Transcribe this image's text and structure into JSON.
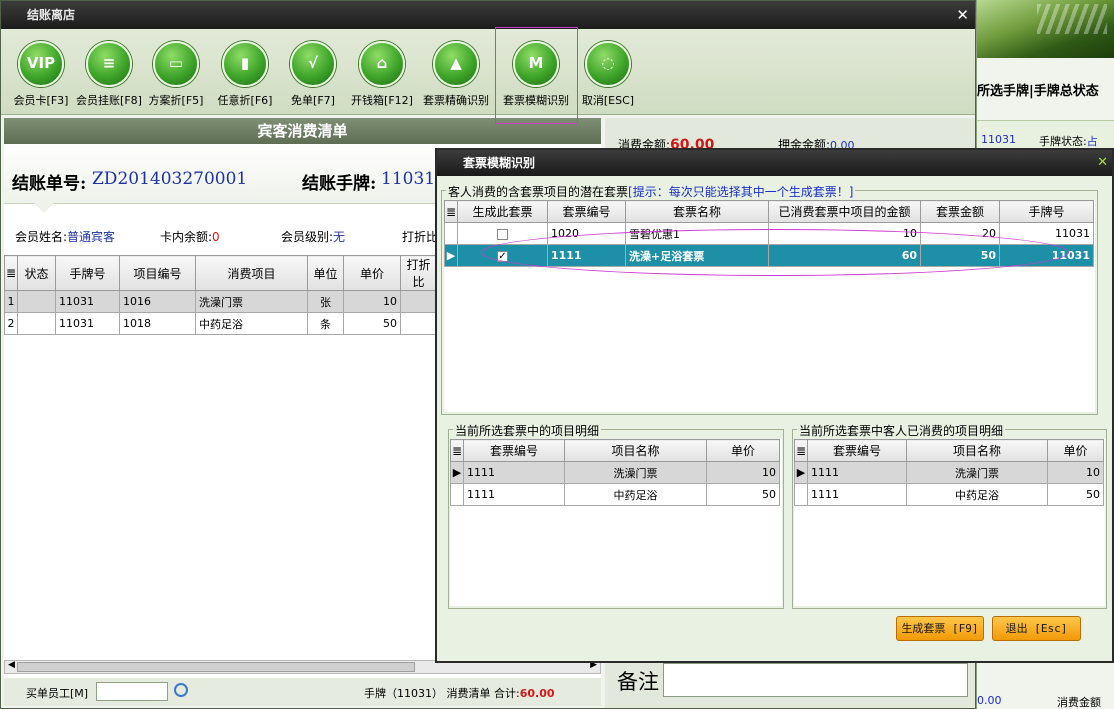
{
  "main_window": {
    "title": "结账离店",
    "toolbar": [
      {
        "icon": "vip-icon",
        "glyph": "VIP",
        "label": "会员卡[F3]"
      },
      {
        "icon": "member-account-icon",
        "glyph": "≡",
        "label": "会员挂账[F8]"
      },
      {
        "icon": "plan-discount-icon",
        "glyph": "▭",
        "label": "方案折[F5]"
      },
      {
        "icon": "any-discount-icon",
        "glyph": "▮",
        "label": "任意折[F6]"
      },
      {
        "icon": "free-order-icon",
        "glyph": "√",
        "label": "免单[F7]"
      },
      {
        "icon": "cash-box-icon",
        "glyph": "⌂",
        "label": "开钱箱[F12]"
      },
      {
        "icon": "exact-ticket-icon",
        "glyph": "▲",
        "label": "套票精确识别"
      },
      {
        "icon": "fuzzy-ticket-icon",
        "glyph": "M",
        "label": "套票模糊识别"
      },
      {
        "icon": "cancel-icon",
        "glyph": "◌",
        "label": "取消[ESC]"
      }
    ],
    "panel_title": "宾客消费清单",
    "bill_label": "结账单号:",
    "bill_no": "ZD201403270001",
    "tag_label": "结账手牌:",
    "tag_no": "11031",
    "info": {
      "name_label": "会员姓名:",
      "name_value": "普通宾客",
      "balance_label": "卡内余额:",
      "balance_value": "0",
      "level_label": "会员级别:",
      "level_value": "无",
      "discount_label": "打折比"
    },
    "table": {
      "headers": [
        "状态",
        "手牌号",
        "项目编号",
        "消费项目",
        "单位",
        "单价",
        "打折比"
      ],
      "rows": [
        {
          "idx": "1",
          "status": "",
          "tag": "11031",
          "code": "1016",
          "item": "洗澡门票",
          "unit": "张",
          "price": "10"
        },
        {
          "idx": "2",
          "status": "",
          "tag": "11031",
          "code": "1018",
          "item": "中药足浴",
          "unit": "条",
          "price": "50"
        }
      ]
    },
    "footer": {
      "staff_label": "买单员工[M]",
      "staff_value": "",
      "summary_prefix": "手牌（11031） 消费清单 合计:",
      "summary_amount": "60.00"
    },
    "right": {
      "consume_label": "消费金额:",
      "consume_value": "60.00",
      "deposit_label": "押金金额:",
      "deposit_value": "0.00",
      "memo_label": "备注"
    }
  },
  "bg_app": {
    "title": "所选手牌|手牌总状态",
    "tag": "11031",
    "status_label": "手牌状态:",
    "status_value": "占",
    "bottom_left": "0.00",
    "bottom_right": "消费金额"
  },
  "dialog": {
    "title": "套票模糊识别",
    "group1_label": "客人消费的含套票项目的潜在套票",
    "group1_hint": "[提示：每次只能选择其中一个生成套票！]",
    "top_headers": [
      "生成此套票",
      "套票编号",
      "套票名称",
      "已消费套票中项目的金额",
      "套票金额",
      "手牌号"
    ],
    "top_rows": [
      {
        "checked": false,
        "code": "1020",
        "name": "雪碧优惠1",
        "consumed": "10",
        "amount": "20",
        "tag": "11031"
      },
      {
        "checked": true,
        "code": "1111",
        "name": "洗澡+足浴套票",
        "consumed": "60",
        "amount": "50",
        "tag": "11031"
      }
    ],
    "left_group_label": "当前所选套票中的项目明细",
    "right_group_label": "当前所选套票中客人已消费的项目明细",
    "detail_headers": [
      "套票编号",
      "项目名称",
      "单价"
    ],
    "left_rows": [
      {
        "code": "1111",
        "name": "洗澡门票",
        "price": "10"
      },
      {
        "code": "1111",
        "name": "中药足浴",
        "price": "50"
      }
    ],
    "right_rows": [
      {
        "code": "1111",
        "name": "洗澡门票",
        "price": "10"
      },
      {
        "code": "1111",
        "name": "中药足浴",
        "price": "50"
      }
    ],
    "generate_button": "生成套票 [F9]",
    "exit_button": "退出 [Esc]"
  },
  "colors": {
    "selection": "#1d8fa6",
    "amount_red": "#d01818",
    "value_blue": "#1d33a8",
    "annotation": "#d23ad5",
    "button_orange": "#f19a08"
  }
}
